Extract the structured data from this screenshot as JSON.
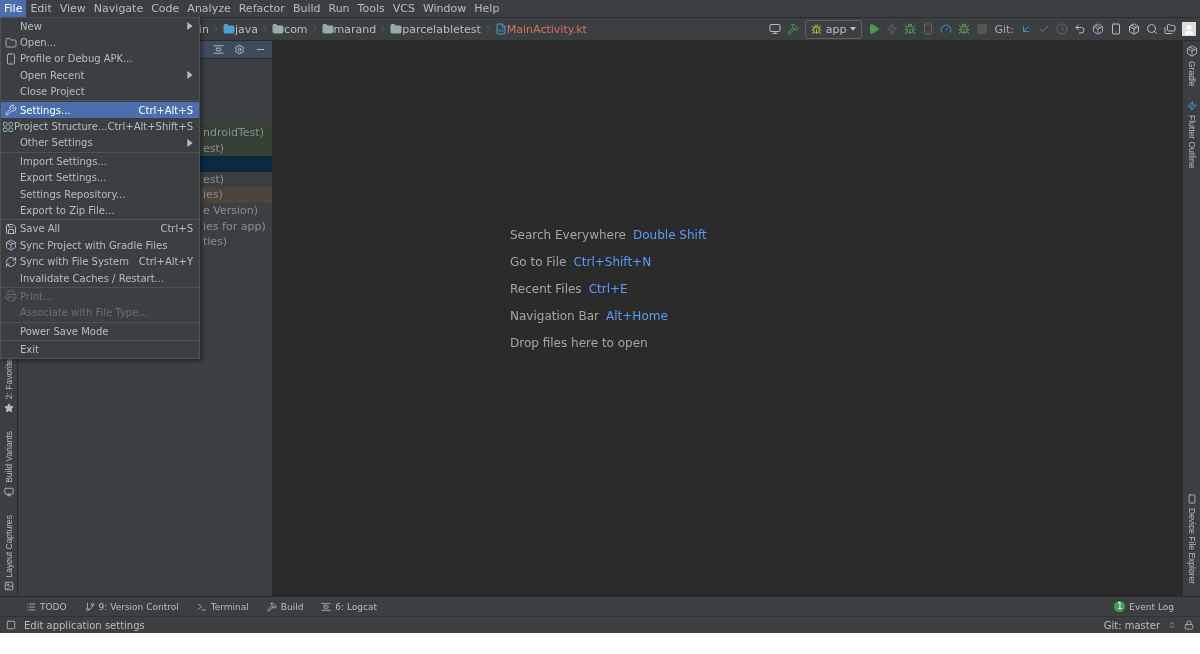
{
  "menu_bar": [
    {
      "label": "File",
      "selected": true
    },
    {
      "label": "Edit",
      "selected": false
    },
    {
      "label": "View",
      "selected": false
    },
    {
      "label": "Navigate",
      "selected": false
    },
    {
      "label": "Code",
      "selected": false
    },
    {
      "label": "Analyze",
      "selected": false
    },
    {
      "label": "Refactor",
      "selected": false
    },
    {
      "label": "Build",
      "selected": false
    },
    {
      "label": "Run",
      "selected": false
    },
    {
      "label": "Tools",
      "selected": false
    },
    {
      "label": "VCS",
      "selected": false
    },
    {
      "label": "Window",
      "selected": false
    },
    {
      "label": "Help",
      "selected": false
    }
  ],
  "breadcrumb": [
    {
      "label": "in",
      "kind": "text"
    },
    {
      "label": "java",
      "kind": "source"
    },
    {
      "label": "com",
      "kind": "package"
    },
    {
      "label": "marand",
      "kind": "package"
    },
    {
      "label": "parcelabletest",
      "kind": "package"
    },
    {
      "label": "MainActivity.kt",
      "kind": "file"
    }
  ],
  "toolbar": {
    "run_config": "app",
    "git_label": "Git:"
  },
  "project_tree": [
    {
      "label": "ndroidTest)",
      "color": "#344134",
      "selected": false
    },
    {
      "label": "est)",
      "color": "#344134",
      "selected": false
    },
    {
      "selected": true
    },
    {
      "label": "est)",
      "selected": false
    },
    {
      "label": "ies)",
      "color": "#49453a",
      "selected": false
    },
    {
      "label": "e Version)",
      "selected": false
    },
    {
      "label": "ies for app)",
      "selected": false
    },
    {
      "label": "ties)",
      "selected": false
    }
  ],
  "file_menu": [
    {
      "kind": "item",
      "label": "New",
      "submenu": true,
      "selected": false,
      "disabled": false
    },
    {
      "kind": "item",
      "label": "Open...",
      "selected": false,
      "disabled": false
    },
    {
      "kind": "item",
      "label": "Profile or Debug APK...",
      "selected": false,
      "disabled": false
    },
    {
      "kind": "item",
      "label": "Open Recent",
      "submenu": true,
      "selected": false,
      "disabled": false
    },
    {
      "kind": "item",
      "label": "Close Project",
      "selected": false,
      "disabled": false
    },
    {
      "kind": "separator"
    },
    {
      "kind": "item",
      "label": "Settings...",
      "shortcut": "Ctrl+Alt+S",
      "selected": true,
      "disabled": false
    },
    {
      "kind": "item",
      "label": "Project Structure...",
      "shortcut": "Ctrl+Alt+Shift+S",
      "selected": false,
      "disabled": false
    },
    {
      "kind": "item",
      "label": "Other Settings",
      "submenu": true,
      "selected": false,
      "disabled": false
    },
    {
      "kind": "separator"
    },
    {
      "kind": "item",
      "label": "Import Settings...",
      "selected": false,
      "disabled": false
    },
    {
      "kind": "item",
      "label": "Export Settings...",
      "selected": false,
      "disabled": false
    },
    {
      "kind": "item",
      "label": "Settings Repository...",
      "selected": false,
      "disabled": false
    },
    {
      "kind": "item",
      "label": "Export to Zip File...",
      "selected": false,
      "disabled": false
    },
    {
      "kind": "separator"
    },
    {
      "kind": "item",
      "label": "Save All",
      "shortcut": "Ctrl+S",
      "selected": false,
      "disabled": false
    },
    {
      "kind": "item",
      "label": "Sync Project with Gradle Files",
      "selected": false,
      "disabled": false
    },
    {
      "kind": "item",
      "label": "Sync with File System",
      "shortcut": "Ctrl+Alt+Y",
      "selected": false,
      "disabled": false
    },
    {
      "kind": "item",
      "label": "Invalidate Caches / Restart...",
      "selected": false,
      "disabled": false
    },
    {
      "kind": "separator"
    },
    {
      "kind": "item",
      "label": "Print...",
      "selected": false,
      "disabled": true
    },
    {
      "kind": "item",
      "label": "Associate with File Type...",
      "selected": false,
      "disabled": true
    },
    {
      "kind": "separator"
    },
    {
      "kind": "item",
      "label": "Power Save Mode",
      "selected": false,
      "disabled": false
    },
    {
      "kind": "separator"
    },
    {
      "kind": "item",
      "label": "Exit",
      "selected": false,
      "disabled": false
    }
  ],
  "editor_hints": [
    {
      "label": "Search Everywhere",
      "shortcut": "Double Shift"
    },
    {
      "label": "Go to File",
      "shortcut": "Ctrl+Shift+N"
    },
    {
      "label": "Recent Files",
      "shortcut": "Ctrl+E"
    },
    {
      "label": "Navigation Bar",
      "shortcut": "Alt+Home"
    },
    {
      "label": "Drop files here to open"
    }
  ],
  "left_stripe": [
    {
      "label": "2: Favorite"
    },
    {
      "label": "Build Variants"
    },
    {
      "label": "Layout Captures"
    }
  ],
  "right_stripe": [
    {
      "label": "Gradle"
    },
    {
      "label": "Flutter Outline"
    },
    {
      "label": "Device File Explorer"
    }
  ],
  "tool_tabs": [
    {
      "label": "TODO"
    },
    {
      "label": "9: Version Control"
    },
    {
      "label": "Terminal"
    },
    {
      "label": "Build"
    },
    {
      "label": "6: Logcat"
    }
  ],
  "event_log": {
    "label": "Event Log",
    "count": "1"
  },
  "status_bar": {
    "message": "Edit application settings",
    "git_branch": "Git: master"
  }
}
